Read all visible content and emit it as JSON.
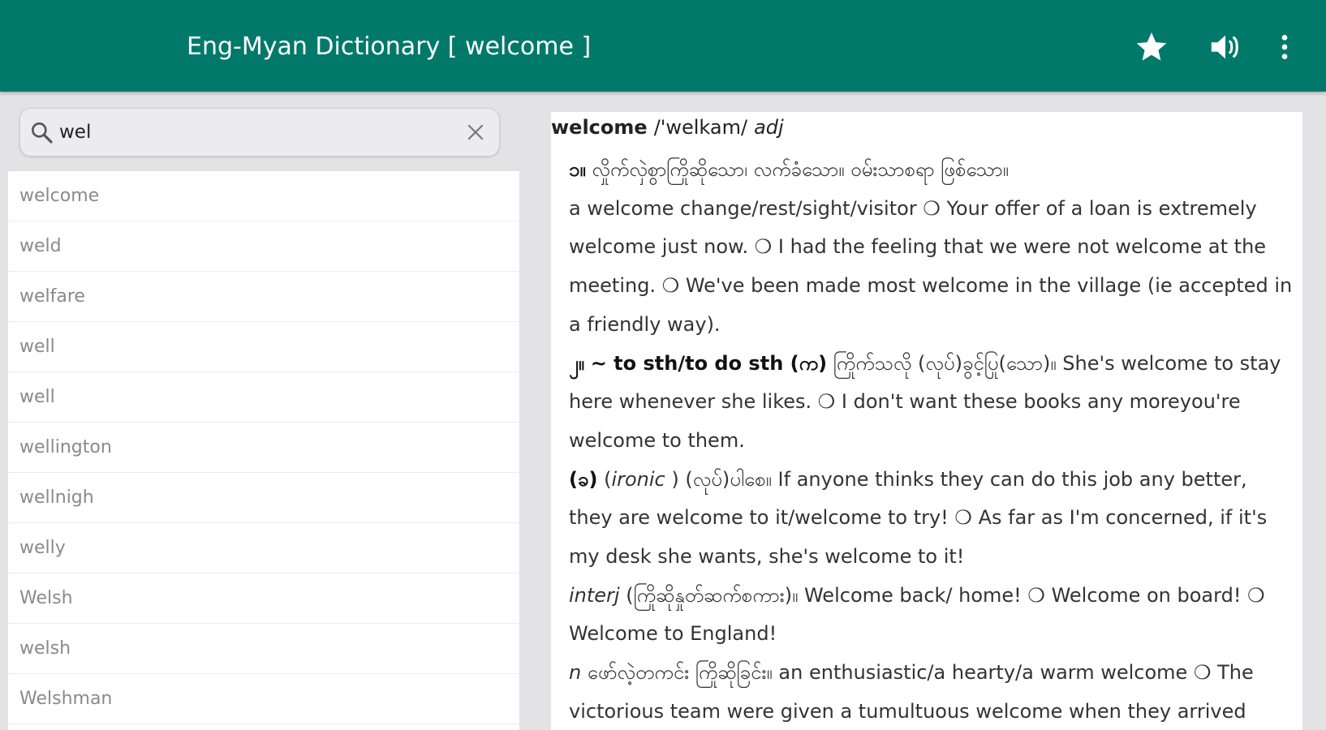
{
  "app": {
    "title": "Eng-Myan Dictionary [ welcome ]",
    "accent": "#00796b",
    "icons": [
      "star-icon",
      "speaker-icon",
      "more-vert-icon"
    ]
  },
  "search": {
    "value": "wel",
    "placeholder": ""
  },
  "word_list": [
    "welcome",
    "weld",
    "welfare",
    "well",
    "well",
    "wellington",
    "wellnigh",
    "welly",
    "Welsh",
    "welsh",
    "Welshman"
  ],
  "definition": {
    "word": "welcome",
    "pronunciation": "/'welkam/",
    "pos": "adj",
    "s1": {
      "num": "၁။",
      "mm": "လှိုက်လှဲစွာကြိုဆိုသော၊ လက်ခံသော။ ဝမ်းသာစရာ ဖြစ်သော။",
      "ex": "a welcome change/rest/sight/visitor ❍ Your offer of a loan is extremely welcome just now. ❍ I had the feeling that we were not welcome at the meeting. ❍ We've been made most welcome in the village (ie accepted in a friendly way)."
    },
    "s2": {
      "num": "၂။",
      "phrase": "~ to sth/to do sth (က)",
      "mm": "ကြိုက်သလို (လုပ်)ခွင့်ပြု(သော)။",
      "ex": "She's welcome to stay here whenever she likes. ❍ I don't want these books any moreyou're welcome to them."
    },
    "s3": {
      "num": "(ခ)",
      "label": "ironic",
      "mm": "(လုပ်)ပါစေ။",
      "ex": "If anyone thinks they can do this job any better, they are welcome to it/welcome to try! ❍ As far as I'm concerned, if it's my desk she wants, she's welcome to it!"
    },
    "interj": {
      "pos": "interj",
      "mm": "(ကြိုဆိုနှုတ်ဆက်စကား)။",
      "ex": "Welcome back/ home! ❍ Welcome on board! ❍ Welcome to England!"
    },
    "noun": {
      "pos": "n",
      "mm": "ဖော်လဲ့တကင်း ကြိုဆိုခြင်း။",
      "ex": "an enthusiastic/a hearty/a warm welcome ❍ The victorious team were given a tumultuous welcome when they arrived"
    }
  }
}
